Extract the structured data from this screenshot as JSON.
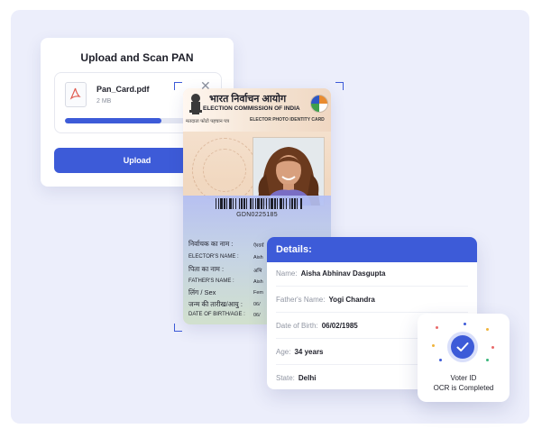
{
  "upload": {
    "title": "Upload and Scan PAN",
    "file_name": "Pan_Card.pdf",
    "file_size": "2 MB",
    "progress_percent": 66,
    "button_label": "Upload",
    "close_symbol": "✕"
  },
  "voter_card": {
    "header_hindi": "भारत निर्वाचन आयोग",
    "header_english": "ELECTION COMMISSION OF INDIA",
    "subheader_hindi": "मतदाता फोटो पहचान पत्र",
    "subheader_english": "ELECTOR PHOTO IDENTITY CARD",
    "card_number": "GDN0225185",
    "fields": [
      {
        "label": "निर्वाचक का नाम :",
        "value": "ऐश्वर्य"
      },
      {
        "label": "ELECTOR'S NAME :",
        "value": "Aish"
      },
      {
        "label": "पिता का नाम     :",
        "value": "अभि"
      },
      {
        "label": "FATHER'S NAME  :",
        "value": "Aish"
      },
      {
        "label": "लिंग / Sex",
        "value": "Fem"
      },
      {
        "label": "जन्म की तारीख/आयु :",
        "value": "06/"
      },
      {
        "label": "DATE OF BIRTH/AGE :",
        "value": "06/"
      }
    ]
  },
  "details": {
    "title": "Details:",
    "rows": [
      {
        "label": "Name:",
        "value": "Aisha Abhinav Dasgupta"
      },
      {
        "label": "Father's Name:",
        "value": "Yogi Chandra"
      },
      {
        "label": "Date of Birth:",
        "value": "06/02/1985"
      },
      {
        "label": "Age:",
        "value": "34 years"
      },
      {
        "label": "State:",
        "value": "Delhi"
      }
    ]
  },
  "status": {
    "line1": "Voter ID",
    "line2": "OCR is Completed"
  },
  "colors": {
    "accent": "#3d5bd8",
    "background": "#eceefb"
  },
  "icons": [
    "pdf-file-icon",
    "close-icon",
    "check-icon"
  ]
}
